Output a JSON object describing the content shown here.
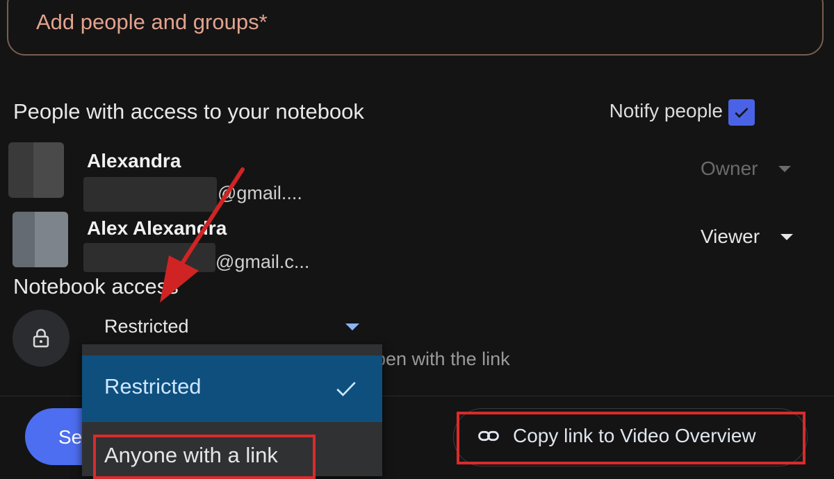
{
  "add_people": {
    "placeholder": "Add people and groups*"
  },
  "people_section": {
    "title": "People with access to your notebook",
    "notify_label": "Notify people",
    "notify_checked": true
  },
  "people": [
    {
      "name": "Alexandra",
      "email_suffix": "@gmail....",
      "role": "Owner",
      "role_enabled": false
    },
    {
      "name": "Alex Alexandra",
      "email_suffix": "@gmail.c...",
      "role": "Viewer",
      "role_enabled": true
    }
  ],
  "access": {
    "title": "Notebook access",
    "selected": "Restricted",
    "helper_partial": "pen with the link",
    "options": [
      {
        "label": "Restricted",
        "selected": true
      },
      {
        "label": "Anyone with a link",
        "selected": false
      }
    ]
  },
  "footer": {
    "send_label_partial": "Se",
    "copy_label": "Copy link to Video Overview"
  },
  "colors": {
    "accent": "#4d6ef0",
    "checkbox": "#4a63e6",
    "selected_option_bg": "#0e4f7d",
    "highlight_red": "#d92b2b",
    "arrow_red": "#d02424"
  },
  "icons": [
    "lock-icon",
    "checkmark-icon",
    "link-icon",
    "dropdown-triangle-icon"
  ]
}
